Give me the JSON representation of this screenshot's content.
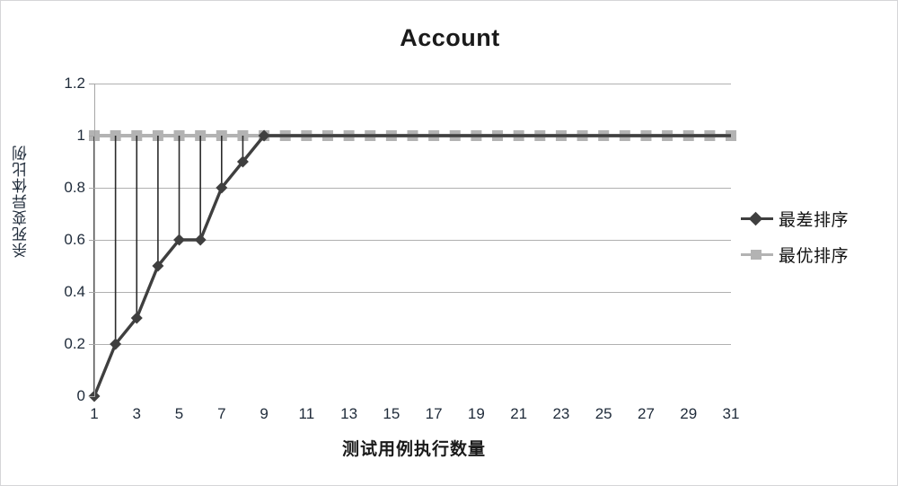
{
  "chart_data": {
    "type": "line",
    "title": "Account",
    "xlabel": "测试用例执行数量",
    "ylabel": "杀死变异体比例",
    "x": [
      1,
      2,
      3,
      4,
      5,
      6,
      7,
      8,
      9,
      10,
      11,
      12,
      13,
      14,
      15,
      16,
      17,
      18,
      19,
      20,
      21,
      22,
      23,
      24,
      25,
      26,
      27,
      28,
      29,
      30,
      31
    ],
    "xlim": [
      1,
      31
    ],
    "ylim": [
      0,
      1.2
    ],
    "yticks": [
      "0",
      "0.2",
      "0.4",
      "0.6",
      "0.8",
      "1",
      "1.2"
    ],
    "ytick_values": [
      0,
      0.2,
      0.4,
      0.6,
      0.8,
      1,
      1.2
    ],
    "xticks": [
      "1",
      "3",
      "5",
      "7",
      "9",
      "11",
      "13",
      "15",
      "17",
      "19",
      "21",
      "23",
      "25",
      "27",
      "29",
      "31"
    ],
    "xtick_values": [
      1,
      3,
      5,
      7,
      9,
      11,
      13,
      15,
      17,
      19,
      21,
      23,
      25,
      27,
      29,
      31
    ],
    "grid": true,
    "legend_position": "right",
    "series": [
      {
        "name": "最差排序",
        "color": "#3f3f3f",
        "marker": "diamond",
        "values": [
          0,
          0.2,
          0.3,
          0.5,
          0.6,
          0.6,
          0.8,
          0.9,
          1,
          1,
          1,
          1,
          1,
          1,
          1,
          1,
          1,
          1,
          1,
          1,
          1,
          1,
          1,
          1,
          1,
          1,
          1,
          1,
          1,
          1,
          1
        ]
      },
      {
        "name": "最优排序",
        "color": "#b3b3b3",
        "marker": "square",
        "values": [
          1,
          1,
          1,
          1,
          1,
          1,
          1,
          1,
          1,
          1,
          1,
          1,
          1,
          1,
          1,
          1,
          1,
          1,
          1,
          1,
          1,
          1,
          1,
          1,
          1,
          1,
          1,
          1,
          1,
          1,
          1
        ]
      }
    ],
    "droplines": {
      "description": "vertical connector lines from worst-order points up to value 1",
      "x": [
        1,
        2,
        3,
        4,
        5,
        6,
        7,
        8
      ],
      "color": "#2b2b2b"
    },
    "colors": {
      "grid": "#b0b0b0",
      "axis": "#a6a6a6",
      "text": "#1f2b3a",
      "title": "#1a1a1a",
      "background": "#ffffff",
      "border": "#d5d5d8"
    }
  },
  "legend": {
    "items": [
      {
        "label": "最差排序"
      },
      {
        "label": "最优排序"
      }
    ]
  }
}
